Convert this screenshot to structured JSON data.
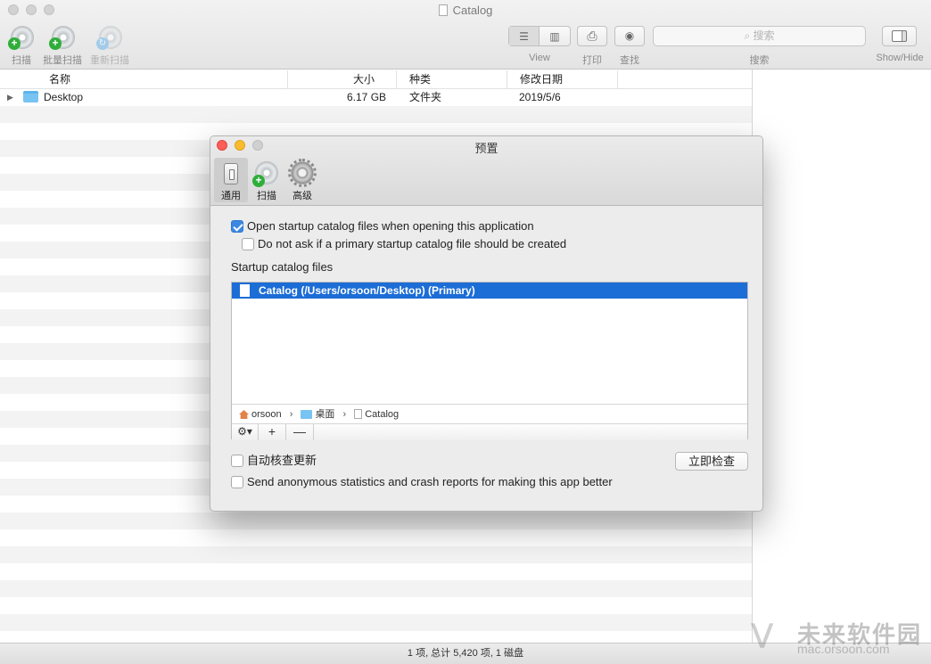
{
  "window": {
    "title": "Catalog"
  },
  "toolbar": {
    "scan_label": "扫描",
    "batch_scan_label": "批量扫描",
    "rescan_label": "重新扫描",
    "view_label": "View",
    "print_label": "打印",
    "find_label": "查找",
    "search_placeholder": "搜索",
    "search_label": "搜索",
    "showhide_label": "Show/Hide"
  },
  "table": {
    "columns": [
      "名称",
      "大小",
      "种类",
      "修改日期"
    ],
    "rows": [
      {
        "name": "Desktop",
        "size": "6.17 GB",
        "kind": "文件夹",
        "modified": "2019/5/6"
      }
    ]
  },
  "status_bar": {
    "text": "1 项, 总计 5,420 项, 1 磁盘"
  },
  "preferences": {
    "title": "预置",
    "tabs": [
      "通用",
      "扫描",
      "高级"
    ],
    "selected_tab": "通用",
    "open_startup_label": "Open startup catalog files when opening this application",
    "open_startup_checked": true,
    "do_not_ask_label": "Do not ask if a primary startup catalog file should be created",
    "do_not_ask_checked": false,
    "startup_files_title": "Startup catalog files",
    "startup_files": [
      "Catalog (/Users/orsoon/Desktop) (Primary)"
    ],
    "path": [
      "orsoon",
      "桌面",
      "Catalog"
    ],
    "add_symbol": "+",
    "remove_symbol": "—",
    "auto_update_label": "自动核查更新",
    "auto_update_checked": false,
    "check_now_label": "立即检查",
    "anonymous_stats_label": "Send anonymous statistics and crash reports for making this app better",
    "anonymous_stats_checked": false
  },
  "watermark": {
    "text": "未来软件园",
    "url": "mac.orsoon.com"
  },
  "colors": {
    "selection": "#1c6dd6",
    "checkbox_checked": "#3b88e0",
    "close": "#fc5f57",
    "minimize": "#fdbc2e"
  }
}
